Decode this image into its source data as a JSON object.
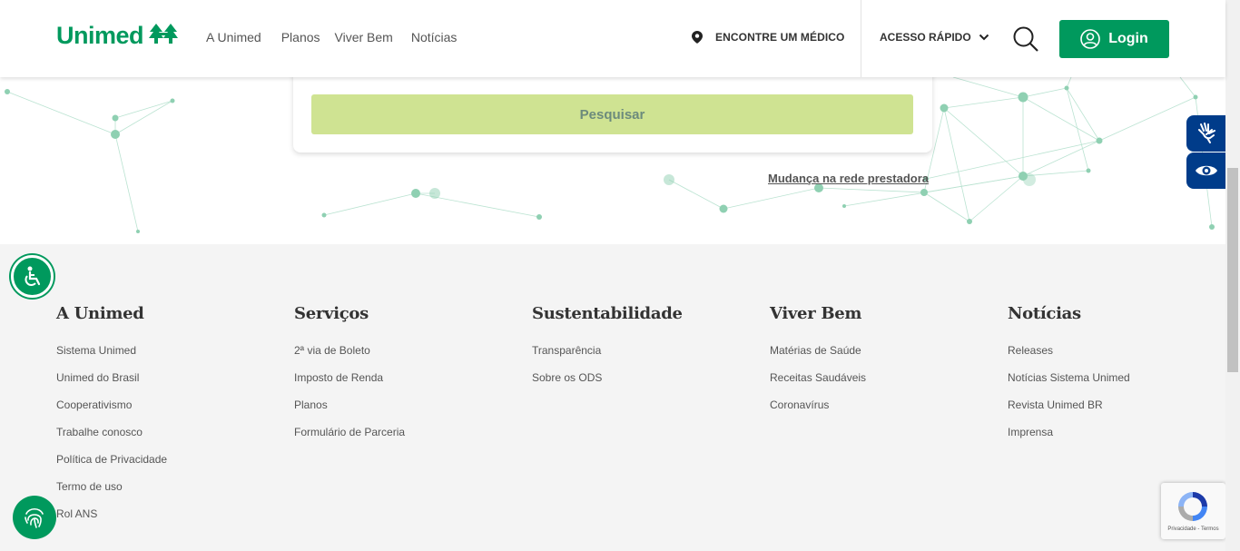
{
  "header": {
    "logo_text": "Unimed",
    "nav": [
      "A Unimed",
      "Planos",
      "Viver Bem",
      "Notícias"
    ],
    "find_doctor": "ENCONTRE UM MÉDICO",
    "quick_access": "ACESSO RÁPIDO",
    "login": "Login"
  },
  "search": {
    "submit_label": "Pesquisar",
    "network_link": "Mudança na rede prestadora"
  },
  "footer": {
    "columns": [
      {
        "title": "A Unimed",
        "links": [
          "Sistema Unimed",
          "Unimed do Brasil",
          "Cooperativismo",
          "Trabalhe conosco",
          "Política de Privacidade",
          "Termo de uso",
          "Rol ANS"
        ]
      },
      {
        "title": "Serviços",
        "links": [
          "2ª via de Boleto",
          "Imposto de Renda",
          "Planos",
          "Formulário de Parceria"
        ]
      },
      {
        "title": "Sustentabilidade",
        "links": [
          "Transparência",
          "Sobre os ODS"
        ]
      },
      {
        "title": "Viver Bem",
        "links": [
          "Matérias de Saúde",
          "Receitas Saudáveis",
          "Coronavírus"
        ]
      },
      {
        "title": "Notícias",
        "links": [
          "Releases",
          "Notícias Sistema Unimed",
          "Revista Unimed BR",
          "Imprensa"
        ]
      }
    ]
  },
  "recaptcha": {
    "text": "Privacidade - Termos"
  },
  "colors": {
    "brand_green": "#00995d",
    "button_lime": "#cfe392",
    "side_blue": "#003c8a"
  },
  "icons": [
    "tree-logo-icon",
    "map-pin-icon",
    "chevron-down-icon",
    "search-icon",
    "user-icon",
    "sign-language-icon",
    "eye-icon",
    "accessibility-icon",
    "fingerprint-icon",
    "recaptcha-icon"
  ]
}
